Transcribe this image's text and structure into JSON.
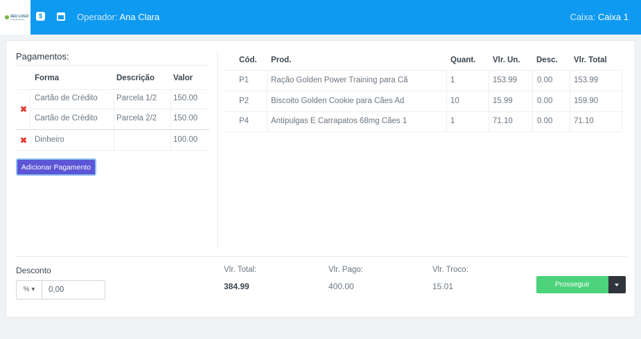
{
  "header": {
    "logo_text": "SEU LOGO",
    "operator_label": "Operador:",
    "operator_name": "Ana Clara",
    "register_label": "Caixa:",
    "register_name": "Caixa 1",
    "icons": [
      "money-icon",
      "calendar-icon"
    ],
    "bar_color": "#0f9af1"
  },
  "payments": {
    "title": "Pagamentos:",
    "columns": [
      "Forma",
      "Descrição",
      "Valor"
    ],
    "groups": [
      {
        "rows": [
          {
            "forma": "Cartão de Crédito",
            "descricao": "Parcela 1/2",
            "valor": "150.00"
          },
          {
            "forma": "Cartão de Crédito",
            "descricao": "Parcela 2/2",
            "valor": "150.00"
          }
        ]
      },
      {
        "rows": [
          {
            "forma": "Dinheiro",
            "descricao": "",
            "valor": "100.00"
          }
        ]
      }
    ],
    "add_button": "Adicionar Pagamento"
  },
  "products": {
    "columns": [
      "Cód.",
      "Prod.",
      "Quant.",
      "Vlr. Un.",
      "Desc.",
      "Vlr. Total"
    ],
    "rows": [
      {
        "cod": "P1",
        "prod": "Ração Golden Power Training para Cã",
        "quant": "1",
        "vlr_un": "153.99",
        "desc": "0.00",
        "vlr_total": "153.99"
      },
      {
        "cod": "P2",
        "prod": "Biscoito Golden Cookie para Cães Ad",
        "quant": "10",
        "vlr_un": "15.99",
        "desc": "0.00",
        "vlr_total": "159.90"
      },
      {
        "cod": "P4",
        "prod": "Antipulgas E Carrapatos 68mg Cães 1",
        "quant": "1",
        "vlr_un": "71.10",
        "desc": "0.00",
        "vlr_total": "71.10"
      }
    ]
  },
  "footer": {
    "discount_label": "Desconto",
    "discount_type": "%",
    "discount_value": "0,00",
    "total_label": "Vlr. Total:",
    "total_value": "384.99",
    "paid_label": "Vlr. Pago:",
    "paid_value": "400.00",
    "change_label": "Vlr. Troco:",
    "change_value": "15.01",
    "proceed_button": "Prosseguir",
    "proceed_color": "#4cd37b",
    "add_payment_color": "#5c55d6"
  }
}
